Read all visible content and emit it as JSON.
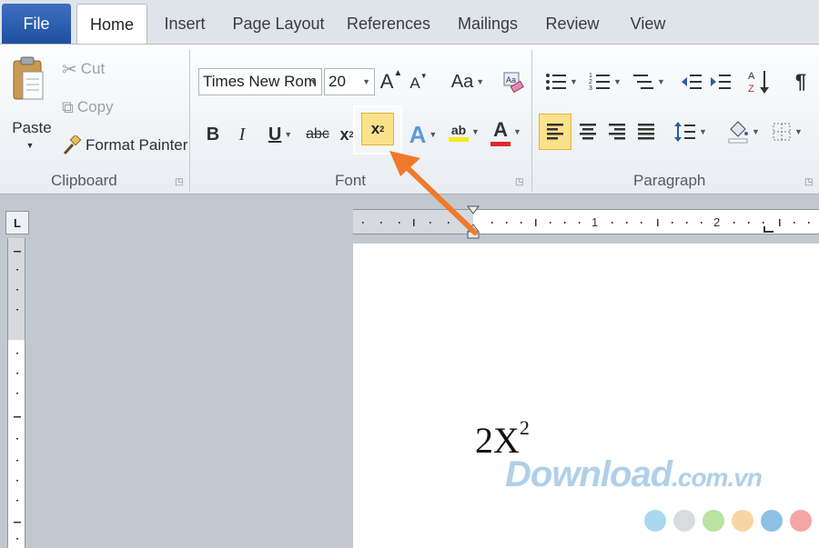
{
  "tabs": {
    "file": "File",
    "home": "Home",
    "insert": "Insert",
    "page_layout": "Page Layout",
    "references": "References",
    "mailings": "Mailings",
    "review": "Review",
    "view": "View"
  },
  "clipboard": {
    "paste": "Paste",
    "cut": "Cut",
    "copy": "Copy",
    "format_painter": "Format Painter",
    "group_label": "Clipboard"
  },
  "font": {
    "font_name": "Times New Rom",
    "font_size": "20",
    "grow": "A",
    "shrink": "A",
    "change_case": "Aa",
    "bold": "B",
    "italic": "I",
    "underline": "U",
    "strikethrough": "abc",
    "subscript": "x",
    "subscript_mark": "2",
    "superscript": "x",
    "superscript_mark": "2",
    "text_effects": "A",
    "highlight": "ab",
    "font_color": "A",
    "group_label": "Font"
  },
  "paragraph": {
    "show_marks": "¶",
    "group_label": "Paragraph"
  },
  "ruler": {
    "corner": "L",
    "mark_1": "1",
    "mark_2": "2"
  },
  "document": {
    "text_base": "2X",
    "text_sup": "2"
  },
  "watermark": {
    "brand": "Download",
    "suffix": ".com.vn",
    "dot_colors": [
      "#a9d9ef",
      "#d9dcdf",
      "#b9e2a3",
      "#f7d6a3",
      "#8ec1e6",
      "#f4a6a6"
    ]
  },
  "colors": {
    "accent_arrow": "#f07a2a",
    "highlight_fill": "#fbe18a",
    "file_tab": "#2b5cad"
  }
}
